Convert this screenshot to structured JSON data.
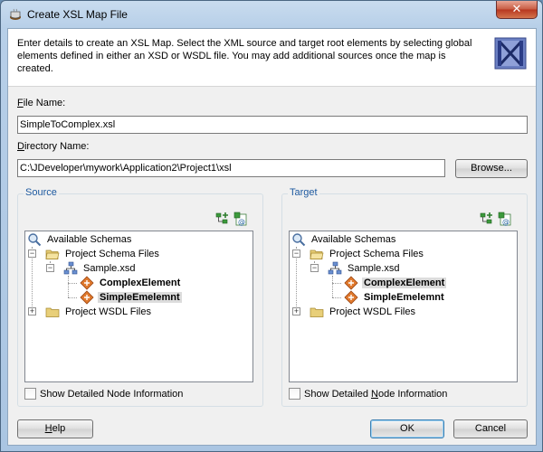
{
  "window": {
    "title": "Create XSL Map File",
    "close_label": "✕"
  },
  "header": {
    "description": "Enter details to create an XSL Map. Select the XML source and target root elements by selecting global elements defined in either an XSD or WSDL file.  You may add additional sources once the map is created."
  },
  "file_name": {
    "label_mnemonic": "F",
    "label_rest": "ile Name:",
    "value": "SimpleToComplex.xsl"
  },
  "directory_name": {
    "label_mnemonic": "D",
    "label_rest": "irectory Name:",
    "value": "C:\\JDeveloper\\mywork\\Application2\\Project1\\xsl",
    "browse_label": "Browse..."
  },
  "source": {
    "legend": "Source",
    "tree": {
      "root": "Available Schemas",
      "project_schema_files": "Project Schema Files",
      "sample_xsd": "Sample.xsd",
      "complex_element": "ComplexElement",
      "simple_element": "SimpleEmelemnt",
      "project_wsdl_files": "Project WSDL Files"
    },
    "checkbox_label": "Show Detailed Node Information"
  },
  "target": {
    "legend": "Target",
    "tree": {
      "root": "Available Schemas",
      "project_schema_files": "Project Schema Files",
      "sample_xsd": "Sample.xsd",
      "complex_element": "ComplexElement",
      "simple_element": "SimpleEmelemnt",
      "project_wsdl_files": "Project WSDL Files"
    },
    "checkbox_label_before": "Show Detailed ",
    "checkbox_label_mnemonic": "N",
    "checkbox_label_after": "ode Information"
  },
  "footer": {
    "help_mnemonic": "H",
    "help_rest": "elp",
    "ok_label": "OK",
    "cancel_label": "Cancel"
  },
  "colors": {
    "legend_blue": "#1e5aa0",
    "selection_gray": "#dcdcdc",
    "close_red": "#c75a41"
  }
}
